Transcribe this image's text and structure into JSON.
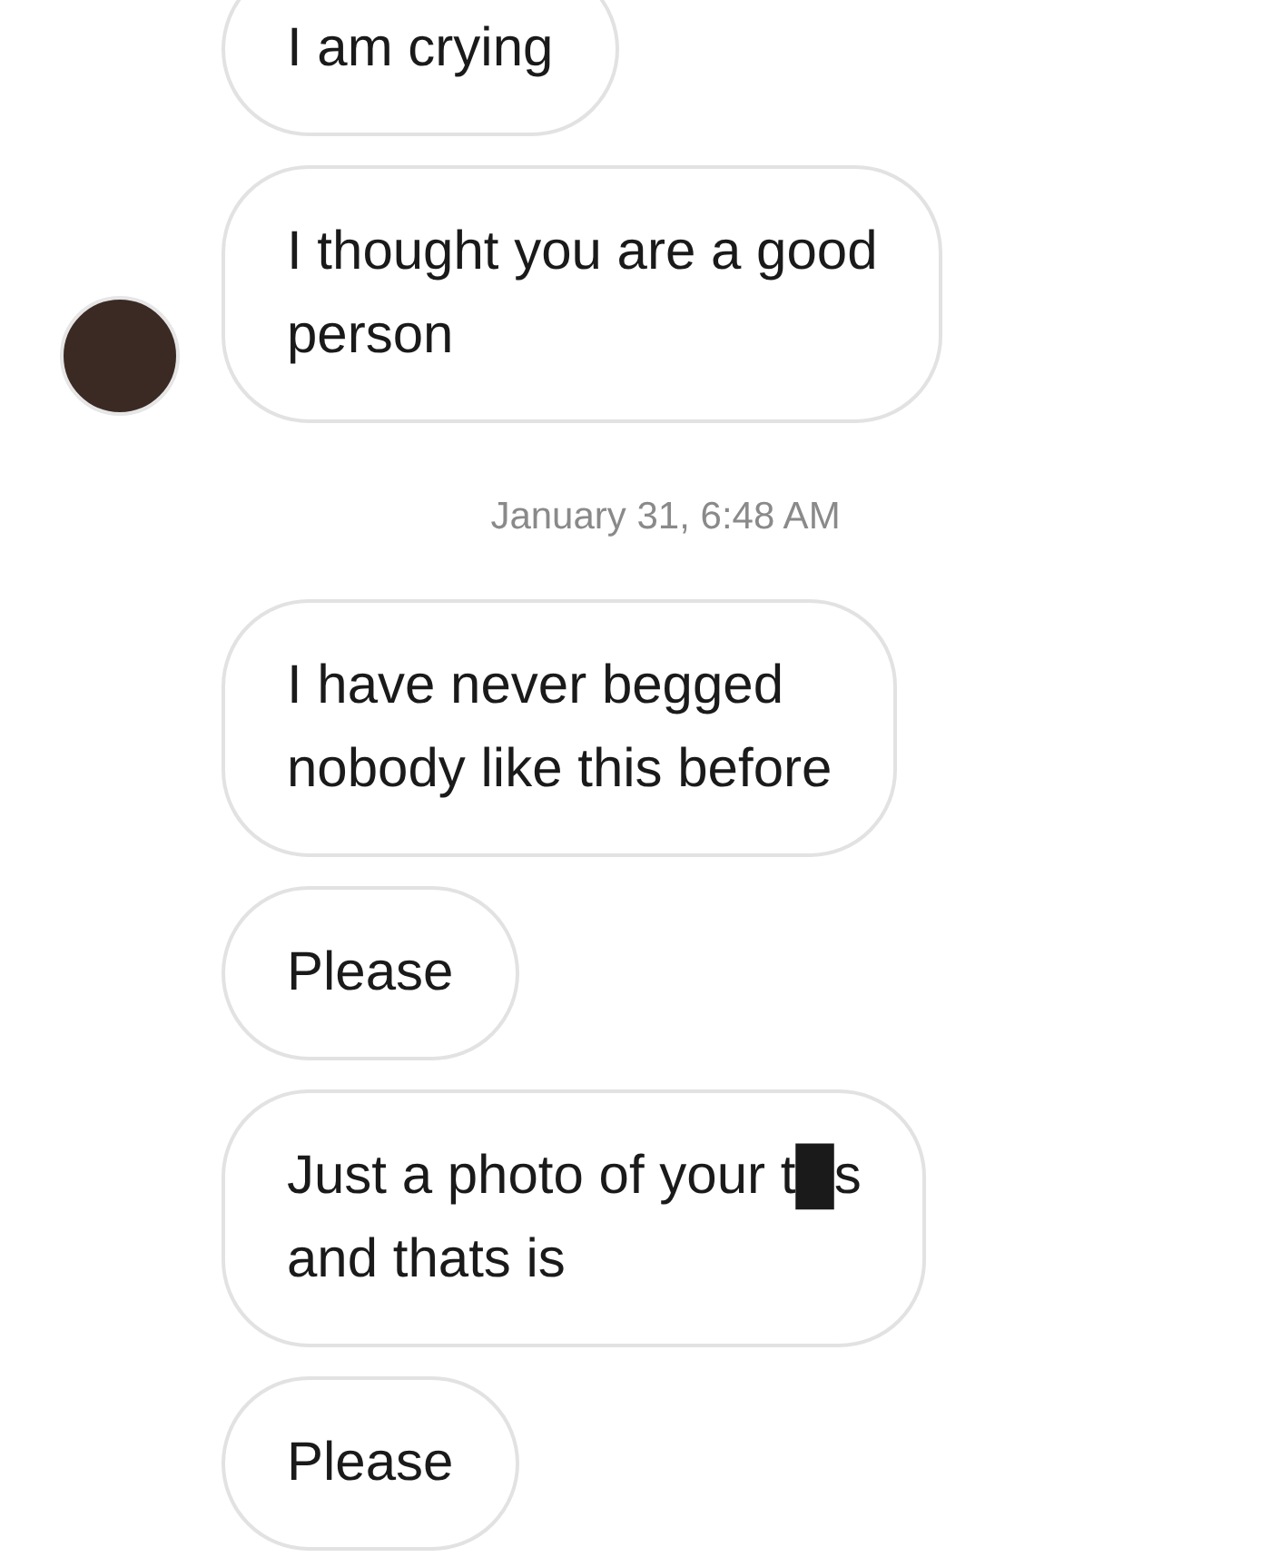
{
  "messages": [
    {
      "kind": "bubble",
      "text": "I am crying",
      "avatar": false
    },
    {
      "kind": "bubble",
      "text": "I thought you are a good\nperson",
      "avatar": true
    },
    {
      "kind": "timestamp",
      "text": "January 31, 6:48 AM"
    },
    {
      "kind": "bubble",
      "text": "I have never begged\nnobody like this before",
      "avatar": false
    },
    {
      "kind": "bubble",
      "text": "Please",
      "avatar": false
    },
    {
      "kind": "bubble",
      "text": "Just a photo of your t█s\nand thats is",
      "avatar": false
    },
    {
      "kind": "bubble",
      "text": "Please",
      "avatar": false
    }
  ]
}
